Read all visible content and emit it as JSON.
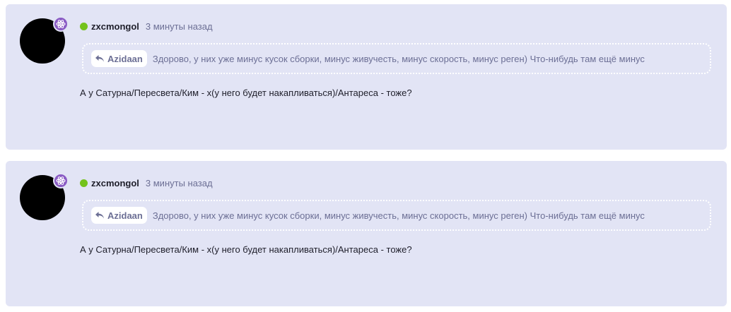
{
  "colors": {
    "card_bg": "#e2e4f5",
    "online": "#74c21c",
    "badge": "#8a5bc4",
    "muted_text": "#6c6f95",
    "text": "#1e1e2a"
  },
  "posts": [
    {
      "avatar_icon": "avatar-black-circle",
      "badge_icon": "atom-icon",
      "username": "zxcmongol",
      "timestamp": "3 минуты назад",
      "quote": {
        "reply_icon": "reply-arrow-icon",
        "author": "Azidaan",
        "text": "Здорово, у них уже минус кусок сборки, минус живучесть, минус скорость, минус реген) Что-нибудь там ещё минус"
      },
      "message": "А у Сатурна/Пересвета/Ким - х(у него будет накапливаться)/Антареса - тоже?"
    },
    {
      "avatar_icon": "avatar-black-circle",
      "badge_icon": "atom-icon",
      "username": "zxcmongol",
      "timestamp": "3 минуты назад",
      "quote": {
        "reply_icon": "reply-arrow-icon",
        "author": "Azidaan",
        "text": "Здорово, у них уже минус кусок сборки, минус живучесть, минус скорость, минус реген) Что-нибудь там ещё минус"
      },
      "message": "А у Сатурна/Пересвета/Ким - х(у него будет накапливаться)/Антареса - тоже?"
    }
  ]
}
